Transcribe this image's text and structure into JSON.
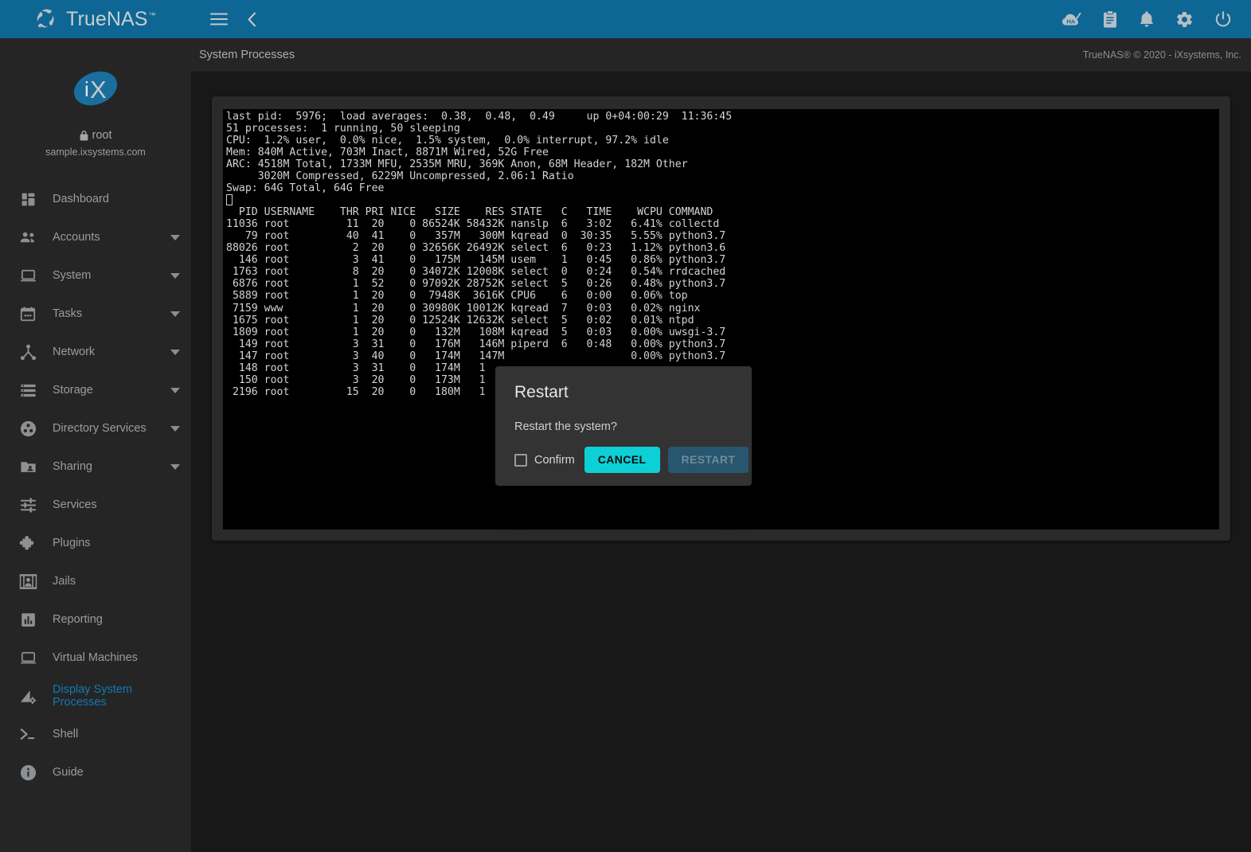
{
  "brand": {
    "name": "TrueNAS",
    "trademark": "™",
    "logo_icon": "truenas-swirl-logo",
    "bar_color": "#0e6694"
  },
  "sidebar": {
    "profile": {
      "avatar_text": "iX",
      "avatar_icon": "ix-oval-logo",
      "lock_icon": "lock-icon",
      "username": "root",
      "hostname": "sample.ixsystems.com"
    },
    "items": [
      {
        "label": "Dashboard",
        "icon": "dashboard-icon",
        "expandable": false,
        "active": false
      },
      {
        "label": "Accounts",
        "icon": "people-icon",
        "expandable": true,
        "active": false
      },
      {
        "label": "System",
        "icon": "laptop-icon",
        "expandable": true,
        "active": false
      },
      {
        "label": "Tasks",
        "icon": "calendar-icon",
        "expandable": true,
        "active": false
      },
      {
        "label": "Network",
        "icon": "network-tree-icon",
        "expandable": true,
        "active": false
      },
      {
        "label": "Storage",
        "icon": "storage-list-icon",
        "expandable": true,
        "active": false
      },
      {
        "label": "Directory Services",
        "icon": "directory-services-icon",
        "expandable": true,
        "active": false
      },
      {
        "label": "Sharing",
        "icon": "folder-shared-icon",
        "expandable": true,
        "active": false
      },
      {
        "label": "Services",
        "icon": "sliders-icon",
        "expandable": false,
        "active": false
      },
      {
        "label": "Plugins",
        "icon": "puzzle-piece-icon",
        "expandable": false,
        "active": false
      },
      {
        "label": "Jails",
        "icon": "jail-bars-icon",
        "expandable": false,
        "active": false
      },
      {
        "label": "Reporting",
        "icon": "bar-chart-icon",
        "expandable": false,
        "active": false
      },
      {
        "label": "Virtual Machines",
        "icon": "monitor-icon",
        "expandable": false,
        "active": false
      },
      {
        "label": "Display System Processes",
        "icon": "processes-gear-icon",
        "expandable": false,
        "active": true
      },
      {
        "label": "Shell",
        "icon": "terminal-prompt-icon",
        "expandable": false,
        "active": false
      },
      {
        "label": "Guide",
        "icon": "info-circle-icon",
        "expandable": false,
        "active": false
      }
    ],
    "active_color": "#1279b5"
  },
  "topbar": {
    "menu_icon": "hamburger-menu-icon",
    "back_icon": "chevron-left-icon",
    "right_icons": [
      {
        "name": "ha-status-icon",
        "title": "HA"
      },
      {
        "name": "jobs-clipboard-icon",
        "title": "Jobs"
      },
      {
        "name": "notifications-bell-icon",
        "title": "Alerts"
      },
      {
        "name": "settings-gear-icon",
        "title": "Settings"
      },
      {
        "name": "power-icon",
        "title": "Power"
      }
    ]
  },
  "breadcrumb": {
    "title": "System Processes",
    "copyright": "TrueNAS® © 2020 - iXsystems, Inc."
  },
  "terminal": {
    "header_lines": [
      "last pid:  5976;  load averages:  0.38,  0.48,  0.49     up 0+04:00:29  11:36:45",
      "51 processes:  1 running, 50 sleeping",
      "CPU:  1.2% user,  0.0% nice,  1.5% system,  0.0% interrupt, 97.2% idle",
      "Mem: 840M Active, 703M Inact, 8871M Wired, 52G Free",
      "ARC: 4518M Total, 1733M MFU, 2535M MRU, 369K Anon, 68M Header, 182M Other",
      "     3020M Compressed, 6229M Uncompressed, 2.06:1 Ratio",
      "Swap: 64G Total, 64G Free"
    ],
    "column_header": "  PID USERNAME    THR PRI NICE   SIZE    RES STATE   C   TIME    WCPU COMMAND",
    "rows": [
      "11036 root         11  20    0 86524K 58432K nanslp  6   3:02   6.41% collectd",
      "   79 root         40  41    0   357M   300M kqread  0  30:35   5.55% python3.7",
      "88026 root          2  20    0 32656K 26492K select  6   0:23   1.12% python3.6",
      "  146 root          3  41    0   175M   145M usem    1   0:45   0.86% python3.7",
      " 1763 root          8  20    0 34072K 12008K select  0   0:24   0.54% rrdcached",
      " 6876 root          1  52    0 97092K 28752K select  5   0:26   0.48% python3.7",
      " 5889 root          1  20    0  7948K  3616K CPU6    6   0:00   0.06% top",
      " 7159 www           1  20    0 30980K 10012K kqread  7   0:03   0.02% nginx",
      " 1675 root          1  20    0 12524K 12632K select  5   0:02   0.01% ntpd",
      " 1809 root          1  20    0   132M   108M kqread  5   0:03   0.00% uwsgi-3.7",
      "  149 root          3  31    0   176M   146M piperd  6   0:48   0.00% python3.7",
      "  147 root          3  40    0   174M   147M                    0.00% python3.7",
      "  148 root          3  31    0   174M   1",
      "  150 root          3  20    0   173M   1",
      " 2196 root         15  20    0   180M   1"
    ]
  },
  "dialog": {
    "title": "Restart",
    "message": "Restart the system?",
    "confirm_label": "Confirm",
    "confirm_checked": false,
    "checkbox_icon": "checkbox-unchecked-icon",
    "cancel_label": "CANCEL",
    "restart_label": "RESTART",
    "restart_disabled": true,
    "cancel_color": "#0cd0d6",
    "restart_color": "#27566e"
  }
}
